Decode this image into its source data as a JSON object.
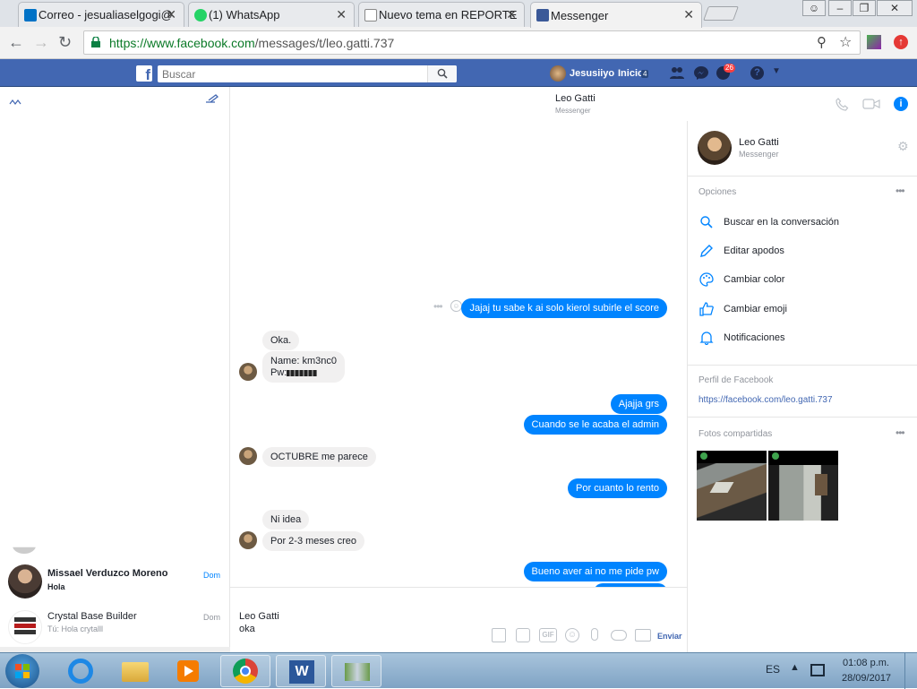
{
  "browser": {
    "tabs": [
      {
        "title": "Correo - jesualiaselgogi@",
        "icon_color": "#0072c6"
      },
      {
        "title": "(1) WhatsApp",
        "icon_color": "#25d366"
      },
      {
        "title": "Nuevo tema en REPORTE",
        "icon_color": "#888888"
      },
      {
        "title": "Messenger",
        "icon_color": "#3b5998"
      }
    ],
    "url_secure": "https://www.facebook.com",
    "url_path": "/messages/t/leo.gatti.737"
  },
  "facebook": {
    "search_placeholder": "Buscar",
    "profile_name": "Jesusiiyo",
    "home_label": "Inicio",
    "home_count": "4",
    "notifications_count": "26"
  },
  "conversation": {
    "contact_name": "Leo Gatti",
    "contact_subtitle": "Messenger",
    "messages": [
      {
        "from": "me",
        "text": "Jajaj tu sabe k ai solo kierol subirle el score"
      },
      {
        "from": "them",
        "text": "Oka."
      },
      {
        "from": "them",
        "text": "Name: km3nc0"
      },
      {
        "from": "them",
        "text": "Pw:"
      },
      {
        "from": "me",
        "text": "Ajajja grs"
      },
      {
        "from": "me",
        "text": "Cuando se le acaba el admin"
      },
      {
        "from": "them",
        "text": "OCTUBRE me parece"
      },
      {
        "from": "me",
        "text": "Por cuanto lo rento"
      },
      {
        "from": "them",
        "text": "Ni idea"
      },
      {
        "from": "them",
        "text": "Por 2-3 meses creo"
      },
      {
        "from": "me",
        "text": "Bueno aver ai no me pide pw"
      }
    ],
    "composer_name": "Leo Gatti",
    "composer_text": "oka",
    "send_label": "Enviar"
  },
  "threads": [
    {
      "name": "Missael Verduzco Moreno",
      "preview": "Hola",
      "date": "Dom",
      "unread": true
    },
    {
      "name": "Crystal Base Builder",
      "preview": "Tú: Hola crytalll",
      "date": "Dom",
      "unread": false
    }
  ],
  "details": {
    "name": "Leo Gatti",
    "subtitle": "Messenger",
    "options_title": "Opciones",
    "options": [
      {
        "label": "Buscar en la conversación",
        "icon": "search-icon"
      },
      {
        "label": "Editar apodos",
        "icon": "pencil-icon"
      },
      {
        "label": "Cambiar color",
        "icon": "palette-icon"
      },
      {
        "label": "Cambiar emoji",
        "icon": "thumbs-up-icon"
      },
      {
        "label": "Notificaciones",
        "icon": "bell-icon"
      }
    ],
    "profile_title": "Perfil de Facebook",
    "profile_link": "https://facebook.com/leo.gatti.737",
    "photos_title": "Fotos compartidas"
  },
  "taskbar": {
    "language": "ES",
    "time": "01:08 p.m.",
    "date": "28/09/2017"
  },
  "colors": {
    "fb_blue": "#4267b2",
    "messenger_blue": "#0084ff",
    "bubble_gray": "#f1f0f0"
  }
}
